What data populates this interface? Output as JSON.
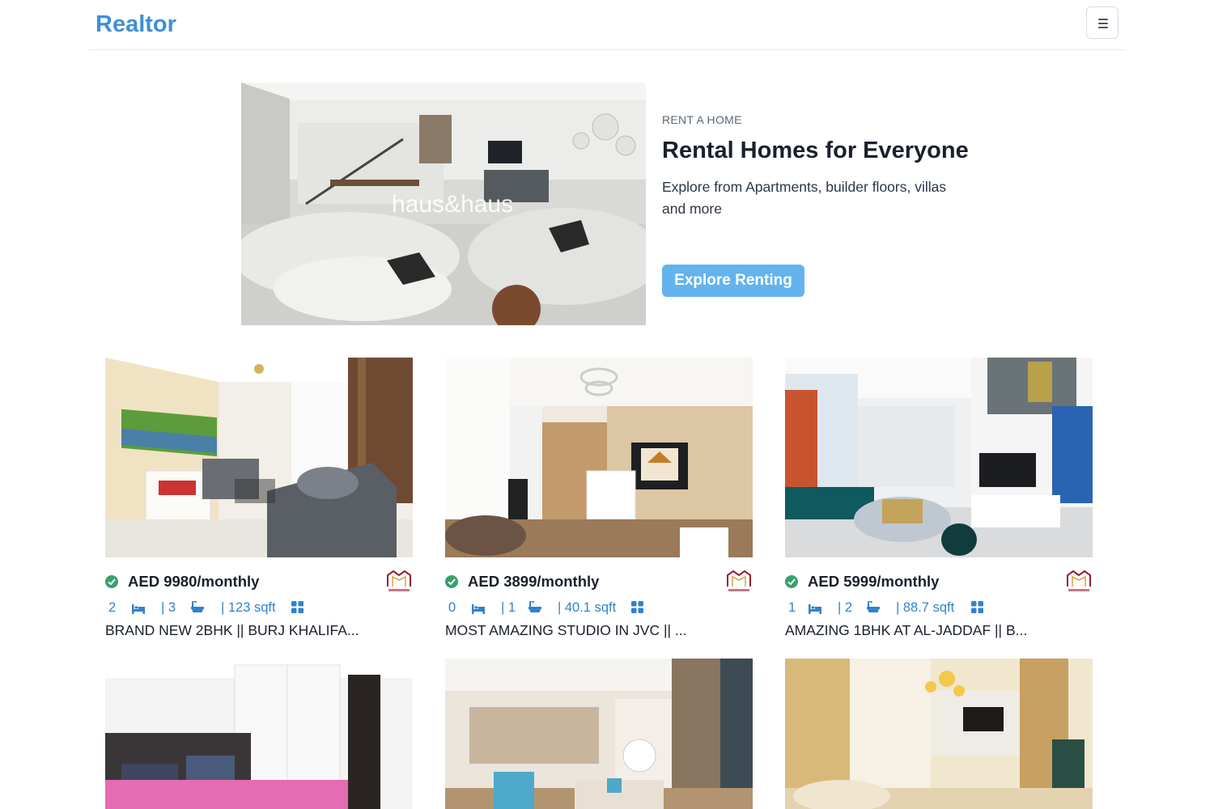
{
  "navbar": {
    "brand": "Realtor"
  },
  "hero": {
    "eyebrow": "RENT A HOME",
    "title": "Rental Homes for Everyone",
    "description": "Explore from Apartments, builder floors, villas and more",
    "cta_label": "Explore Renting",
    "image_watermark": "haus&haus"
  },
  "colors": {
    "brand": "#3f8fd6",
    "cta": "#63b3ed",
    "verified": "#38a169",
    "stats": "#3182ce"
  },
  "listings": [
    {
      "price": "AED 9980/monthly",
      "rooms": "2",
      "baths": "| 3",
      "area": "| 123 sqft",
      "title": "BRAND NEW 2BHK || BURJ KHALIFA...",
      "verified": true,
      "agency_logo": "PEACEFULL"
    },
    {
      "price": "AED 3899/monthly",
      "rooms": "0",
      "baths": "| 1",
      "area": "| 40.1 sqft",
      "title": "MOST AMAZING STUDIO IN JVC || ...",
      "verified": true,
      "agency_logo": "PEACEFULL"
    },
    {
      "price": "AED 5999/monthly",
      "rooms": "1",
      "baths": "| 2",
      "area": "| 88.7 sqft",
      "title": "AMAZING 1BHK AT AL-JADDAF || B...",
      "verified": true,
      "agency_logo": "PEACEFULL"
    },
    {
      "photo": "bedroom-photo"
    },
    {
      "photo": "living-room-photo"
    },
    {
      "photo": "golden-living-room-photo"
    }
  ],
  "icons": {
    "menu": "hamburger-icon",
    "verified": "check-circle-icon",
    "bed": "bed-icon",
    "bath": "bath-icon",
    "area": "grid-icon"
  }
}
